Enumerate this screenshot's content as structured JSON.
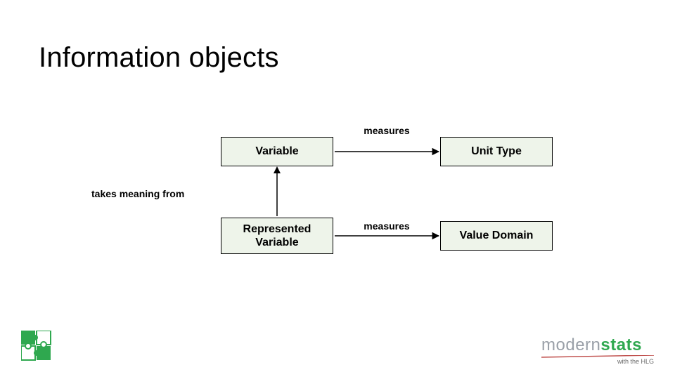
{
  "title": "Information objects",
  "nodes": {
    "variable": "Variable",
    "unit_type": "Unit Type",
    "represented_variable": "Represented\nVariable",
    "value_domain": "Value Domain"
  },
  "relations": {
    "measures_top": "measures",
    "measures_bottom": "measures",
    "takes_meaning_from": "takes meaning from"
  },
  "branding": {
    "modern": "m",
    "odern": "odern",
    "stats": "stats",
    "subtitle": "with the HLG"
  }
}
